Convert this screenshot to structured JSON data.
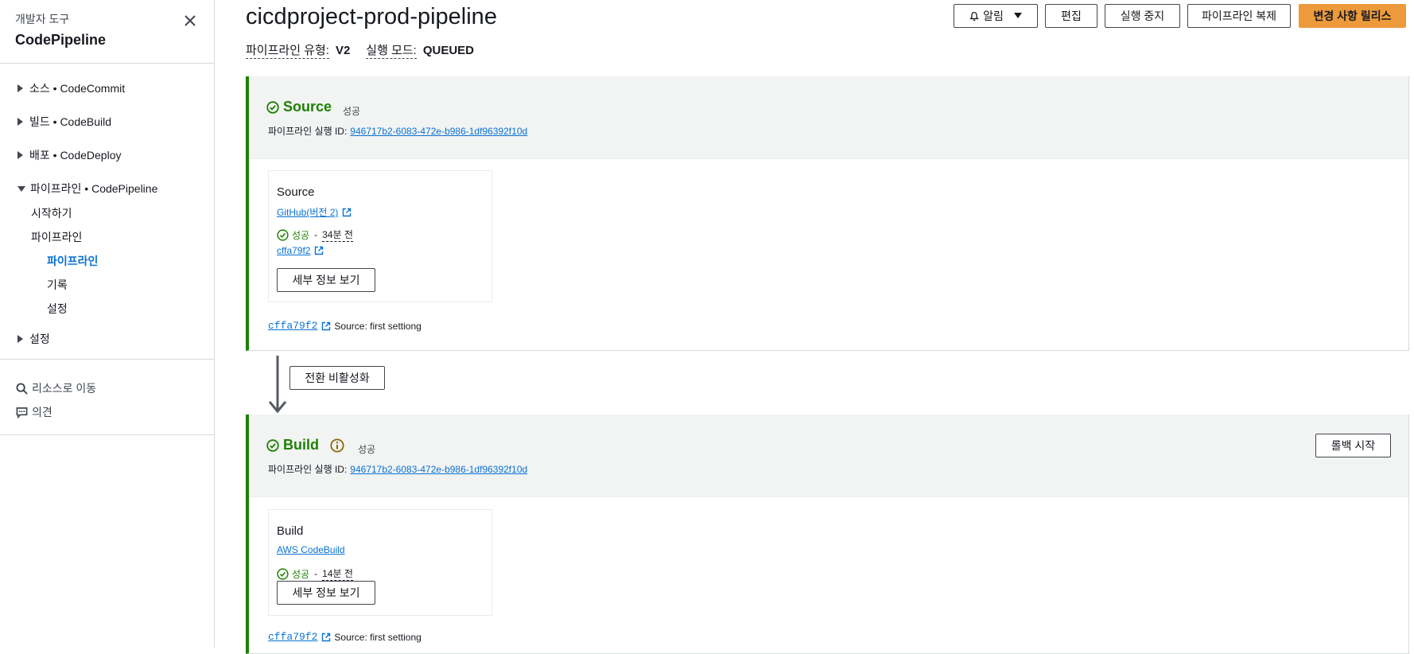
{
  "sidebar": {
    "subtitle": "개발자 도구",
    "title": "CodePipeline",
    "groups": [
      {
        "label": "소스 • CodeCommit"
      },
      {
        "label": "빌드 • CodeBuild"
      },
      {
        "label": "배포 • CodeDeploy"
      },
      {
        "label": "파이프라인 • CodePipeline"
      }
    ],
    "pipeline_links": {
      "getting_started": "시작하기",
      "pipeline": "파이프라인",
      "pipelines": "파이프라인",
      "history": "기록",
      "settings": "설정"
    },
    "settings_group": "설정",
    "go_to_resource": "리소스로 이동",
    "feedback": "의견"
  },
  "header": {
    "title": "cicdproject-prod-pipeline",
    "type_label": "파이프라인 유형:",
    "type_value": "V2",
    "mode_label": "실행 모드:",
    "mode_value": "QUEUED"
  },
  "toolbar": {
    "notify": "알림",
    "edit": "편집",
    "stop": "실행 중지",
    "clone": "파이프라인 복제",
    "release": "변경 사항 릴리스"
  },
  "stages": {
    "source": {
      "name": "Source",
      "status": "성공",
      "exec_label": "파이프라인 실행 ID:",
      "exec_id": "946717b2-6083-472e-b986-1df96392f10d",
      "action": {
        "title": "Source",
        "provider": "GitHub(버전 2)",
        "status": "성공",
        "time": "34분 전",
        "commit": "cffa79f2",
        "details": "세부 정보 보기"
      },
      "commit_id": "cffa79f2",
      "commit_msg": "Source: first settiong"
    },
    "transition": {
      "label": "전환 비활성화"
    },
    "build": {
      "name": "Build",
      "status": "성공",
      "exec_label": "파이프라인 실행 ID:",
      "exec_id": "946717b2-6083-472e-b986-1df96392f10d",
      "rollback": "롤백 시작",
      "action": {
        "title": "Build",
        "provider": "AWS CodeBuild",
        "status": "성공",
        "time": "14분 전",
        "details": "세부 정보 보기"
      },
      "commit_id": "cffa79f2",
      "commit_msg": "Source: first settiong"
    }
  },
  "colors": {
    "success": "#1d8102",
    "link": "#0972d3",
    "primary": "#ec9a3b",
    "info": "#8d6605"
  }
}
